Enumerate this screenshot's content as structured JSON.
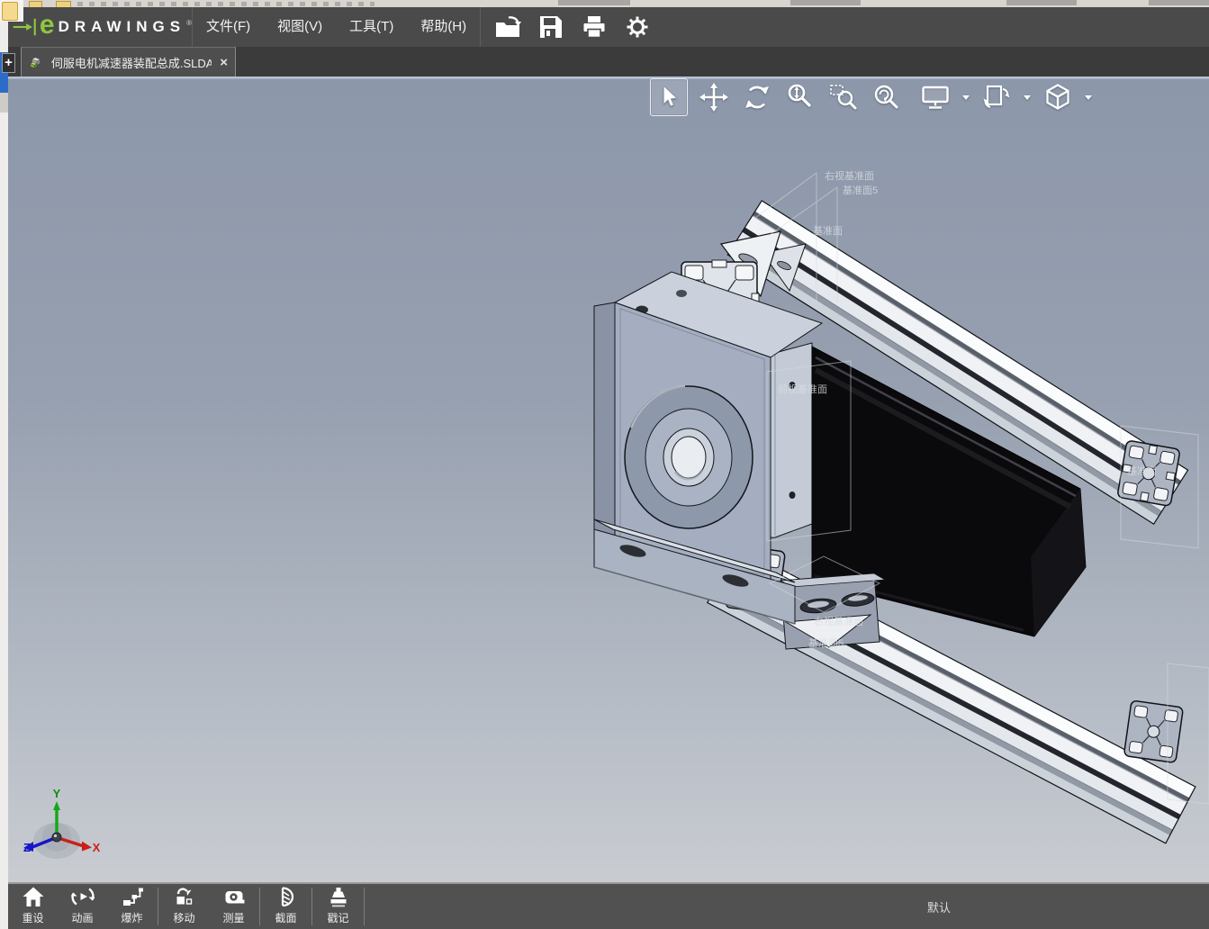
{
  "title_bar": {
    "logo": {
      "e": "e",
      "name": "DRAWINGS",
      "registered": "®"
    },
    "menus": [
      {
        "label": "文件(F)"
      },
      {
        "label": "视图(V)"
      },
      {
        "label": "工具(T)"
      },
      {
        "label": "帮助(H)"
      }
    ],
    "actions": [
      {
        "name": "open"
      },
      {
        "name": "save"
      },
      {
        "name": "print"
      },
      {
        "name": "settings"
      }
    ]
  },
  "tab_bar": {
    "new_tab_label": "+",
    "active_tab": {
      "title": "伺服电机减速器装配总成.SLDASM",
      "close_label": "×"
    }
  },
  "view_toolbar": {
    "tools": [
      {
        "name": "select",
        "active": true,
        "dropdown": false
      },
      {
        "name": "pan",
        "active": false,
        "dropdown": false
      },
      {
        "name": "rotate",
        "active": false,
        "dropdown": false
      },
      {
        "name": "zoom",
        "active": false,
        "dropdown": false
      },
      {
        "name": "zoom-area",
        "active": false,
        "dropdown": false
      },
      {
        "name": "zoom-fit",
        "active": false,
        "dropdown": false
      },
      {
        "name": "full-screen",
        "active": false,
        "dropdown": true
      },
      {
        "name": "model-views",
        "active": false,
        "dropdown": true
      },
      {
        "name": "view-orientation",
        "active": false,
        "dropdown": true
      }
    ]
  },
  "viewport": {
    "datum_annotations": [
      {
        "text": "右视基准面"
      },
      {
        "text": "基准面5"
      },
      {
        "text": "基准面"
      },
      {
        "text": "前视基准面"
      },
      {
        "text": "右视基准面"
      },
      {
        "text": "基准面5"
      },
      {
        "text": "基准面"
      }
    ],
    "triad": {
      "x": "X",
      "y": "Y",
      "z": "Z"
    }
  },
  "bottom_bar": {
    "buttons": [
      {
        "label": "重设",
        "icon": "home"
      },
      {
        "label": "动画",
        "icon": "animation"
      },
      {
        "label": "爆炸",
        "icon": "explode"
      },
      {
        "label": "移动",
        "icon": "move"
      },
      {
        "label": "测量",
        "icon": "measure"
      },
      {
        "label": "截面",
        "icon": "section"
      },
      {
        "label": "戳记",
        "icon": "stamp"
      }
    ],
    "configuration_label": "默认"
  },
  "colors": {
    "titlebar": "#4a4a4a",
    "tabbar": "#3b3b3b",
    "tab_active": "#4e4e4e",
    "viewport_top": "#8c97aa",
    "viewport_bottom": "#c9ccd1",
    "bottombar": "#515151",
    "logo_green": "#8dc63f",
    "axis_x_red": "#c8201a",
    "axis_y_green": "#17a817",
    "axis_z_blue": "#1616c8"
  }
}
